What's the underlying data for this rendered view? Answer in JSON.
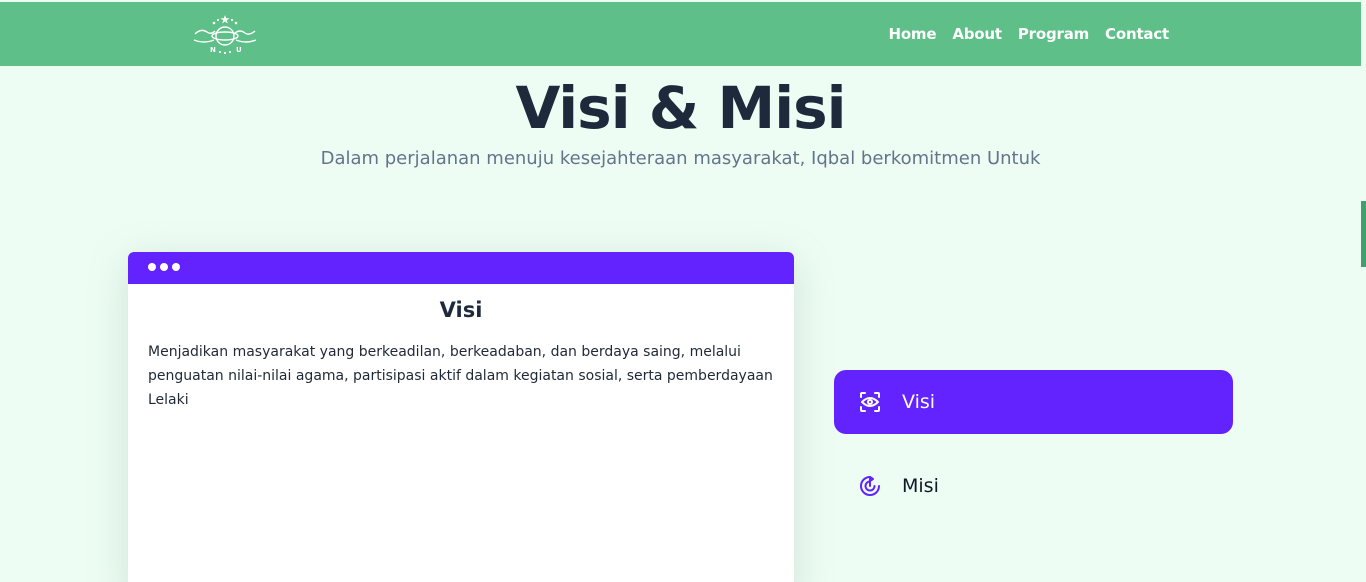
{
  "navbar": {
    "logo_alt": "NU",
    "links": [
      "Home",
      "About",
      "Program",
      "Contact"
    ]
  },
  "hero": {
    "title": "Visi & Misi",
    "subtitle": "Dalam perjalanan menuju kesejahteraan masyarakat, Iqbal berkomitmen Untuk"
  },
  "card": {
    "title": "Visi",
    "text": "Menjadikan masyarakat yang berkeadilan, berkeadaban, dan berdaya saing, melalui penguatan nilai-nilai agama, partisipasi aktif dalam kegiatan sosial, serta pemberdayaan Lelaki"
  },
  "tabs": [
    {
      "label": "Visi",
      "icon": "eye-icon",
      "active": true
    },
    {
      "label": "Misi",
      "icon": "target-icon",
      "active": false
    }
  ],
  "colors": {
    "navbar": "#5ebf88",
    "accent": "#6323ff",
    "background": "#edfdf3"
  }
}
